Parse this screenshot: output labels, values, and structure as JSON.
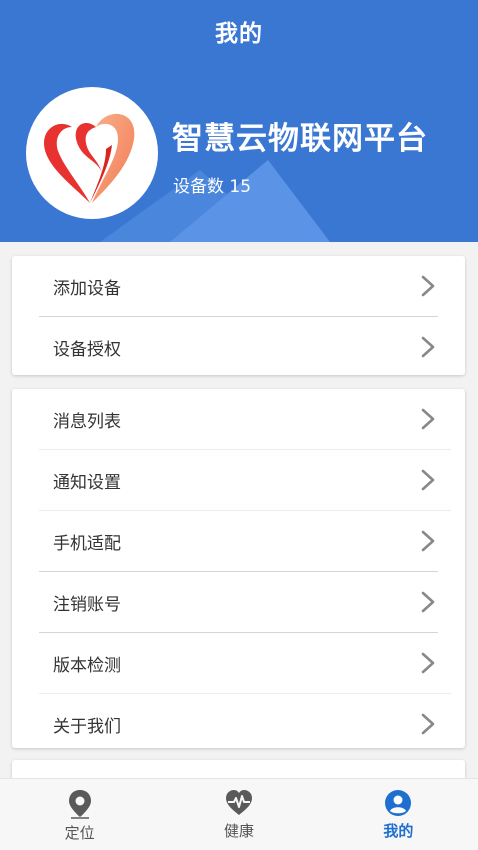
{
  "header": {
    "title": "我的",
    "app_name": "智慧云物联网平台",
    "device_count": "设备数 15"
  },
  "menu_group_1": [
    {
      "label": "添加设备"
    },
    {
      "label": "设备授权"
    }
  ],
  "menu_group_2": [
    {
      "label": "消息列表"
    },
    {
      "label": "通知设置"
    },
    {
      "label": "手机适配"
    },
    {
      "label": "注销账号"
    },
    {
      "label": "版本检测"
    },
    {
      "label": "关于我们"
    }
  ],
  "tabbar": {
    "tabs": [
      {
        "label": "定位",
        "icon": "location-pin-icon"
      },
      {
        "label": "健康",
        "icon": "heartbeat-icon"
      },
      {
        "label": "我的",
        "icon": "user-icon",
        "active": true
      }
    ]
  },
  "colors": {
    "header_bg": "#3a77d3",
    "active_tab": "#1f6fd1",
    "logo_red": "#e8322f"
  }
}
